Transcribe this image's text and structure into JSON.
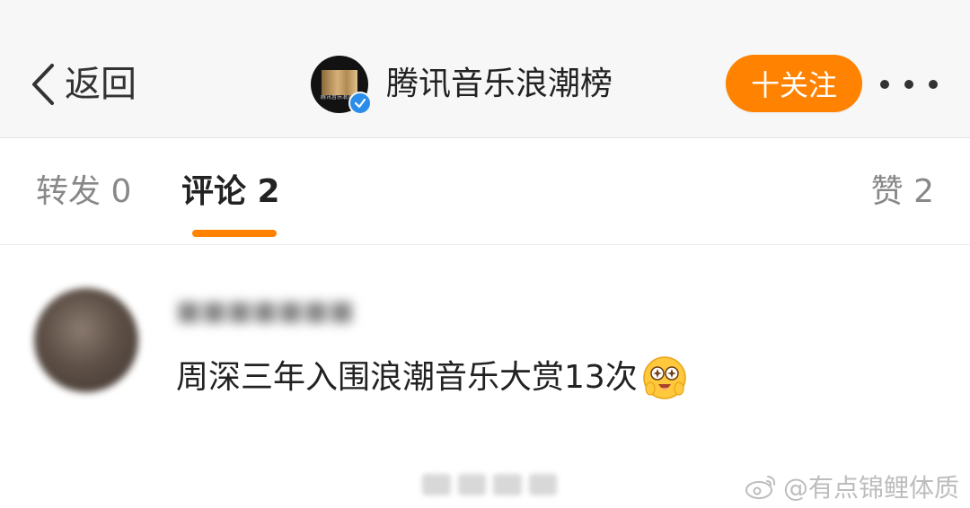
{
  "header": {
    "back_label": "返回",
    "account_name": "腾讯音乐浪潮榜",
    "avatar_text": "腾讯音乐浪潮榜",
    "follow_label": "十关注",
    "more_icon": "ellipsis-icon",
    "verified_icon": "verified-badge-icon"
  },
  "tabs": {
    "repost": "转发 0",
    "comment": "评论 2",
    "like": "赞 2",
    "active": "comment"
  },
  "comment": {
    "username": "■■■■■■■",
    "text": "周深三年入围浪潮音乐大赏13次",
    "emoji": "star-eyed-emoji-icon"
  },
  "watermark": {
    "text": "@有点锦鲤体质"
  },
  "colors": {
    "accent": "#ff8200",
    "header_bg": "#f7f7f7",
    "verified": "#2b8dea"
  }
}
